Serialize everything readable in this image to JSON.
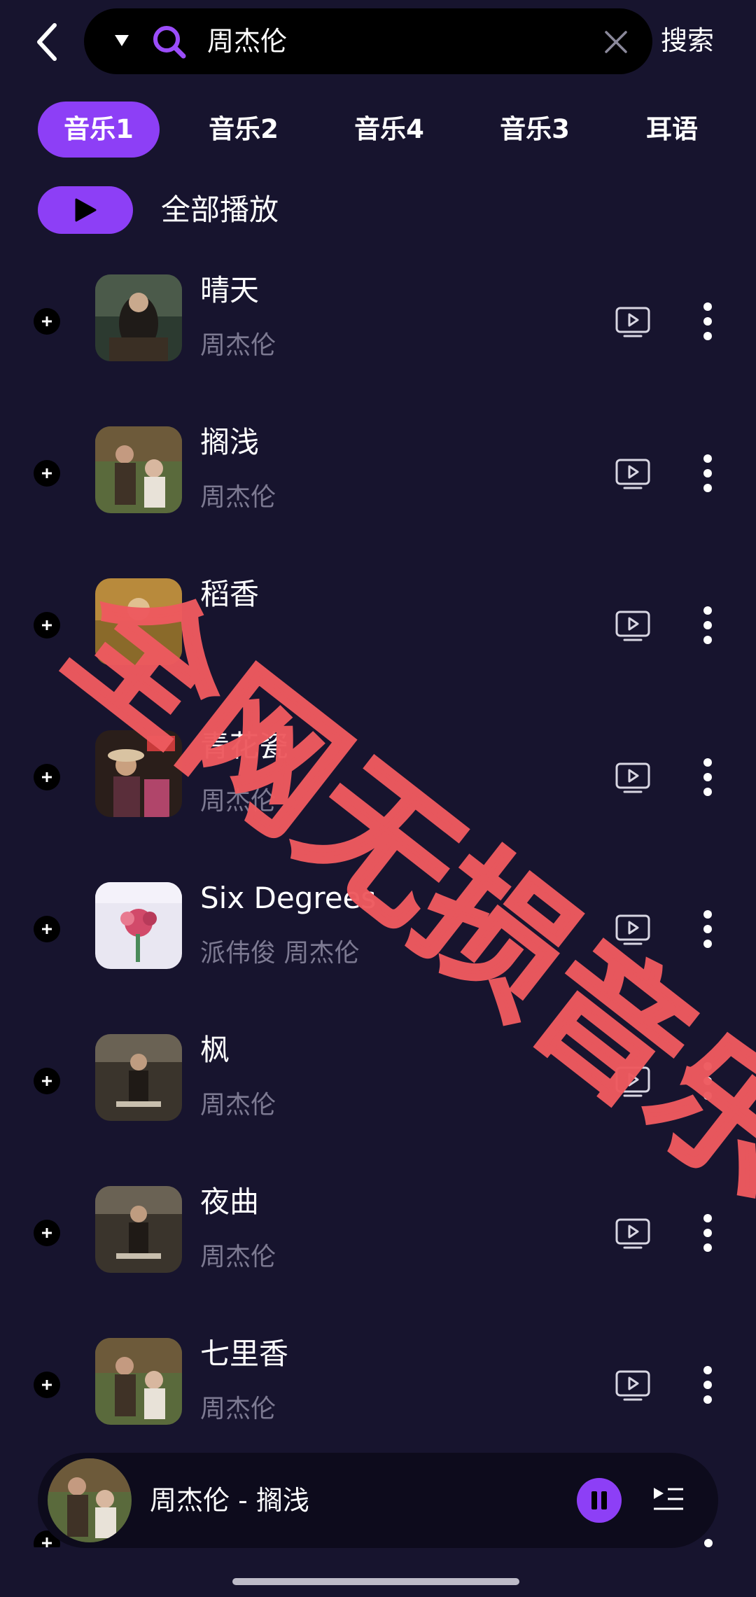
{
  "search": {
    "query": "周杰伦",
    "search_button": "搜索"
  },
  "tabs": [
    {
      "label": "音乐1",
      "active": true
    },
    {
      "label": "音乐2",
      "active": false
    },
    {
      "label": "音乐4",
      "active": false
    },
    {
      "label": "音乐3",
      "active": false
    },
    {
      "label": "耳语",
      "active": false
    }
  ],
  "play_all": {
    "label": "全部播放"
  },
  "songs": [
    {
      "title": "晴天",
      "artist": "周杰伦"
    },
    {
      "title": "搁浅",
      "artist": "周杰伦"
    },
    {
      "title": "稻香",
      "artist": ""
    },
    {
      "title": "青花瓷",
      "artist": "周杰伦"
    },
    {
      "title": "Six Degrees",
      "artist": "派伟俊 周杰伦"
    },
    {
      "title": "枫",
      "artist": "周杰伦"
    },
    {
      "title": "夜曲",
      "artist": "周杰伦"
    },
    {
      "title": "七里香",
      "artist": "周杰伦"
    }
  ],
  "now_playing": {
    "title": "周杰伦 - 搁浅"
  },
  "watermark": "全网无损音乐",
  "colors": {
    "background": "#17142e",
    "accent": "#8d3ff6",
    "watermark": "#ee5a5f",
    "secondary_text": "#7d7a92"
  },
  "icons": [
    "back-arrow-icon",
    "dropdown-triangle-icon",
    "search-icon",
    "clear-icon",
    "play-icon",
    "add-icon",
    "mv-icon",
    "more-icon",
    "pause-icon",
    "playlist-icon"
  ]
}
